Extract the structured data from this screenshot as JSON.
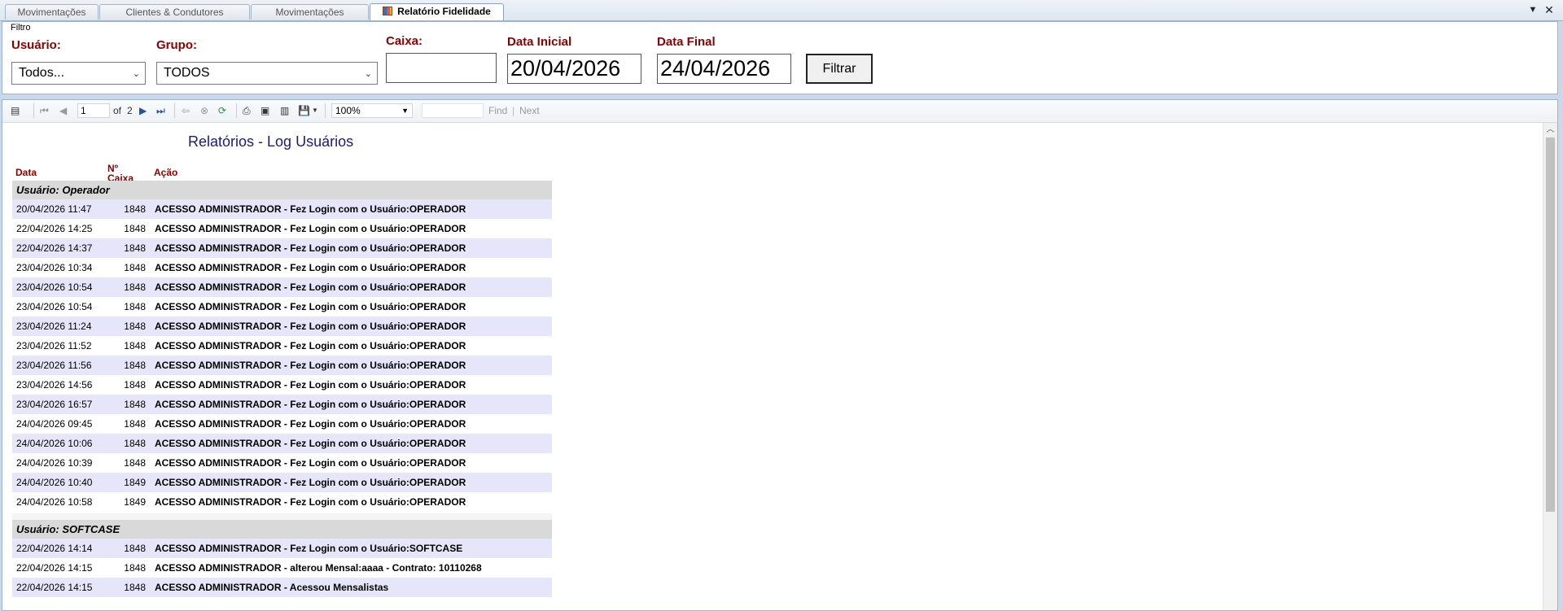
{
  "tabs": [
    {
      "label": "Movimentações"
    },
    {
      "label": "Clientes & Condutores"
    },
    {
      "label": "Movimentações"
    },
    {
      "label": "Relatório Fidelidade"
    }
  ],
  "filter": {
    "legend": "Filtro",
    "usuario_label": "Usuário:",
    "usuario_value": "Todos...",
    "grupo_label": "Grupo:",
    "grupo_value": "TODOS",
    "caixa_label": "Caixa:",
    "caixa_value": "",
    "data_inicial_label": "Data Inicial",
    "data_inicial_value": "20/04/2026",
    "data_final_label": "Data Final",
    "data_final_value": "24/04/2026",
    "filtrar_label": "Filtrar"
  },
  "toolbar": {
    "page_current": "1",
    "page_of": "of",
    "page_total": "2",
    "zoom": "100%",
    "find_label": "Find",
    "separator": "|",
    "next_label": "Next"
  },
  "report": {
    "title": "Relatórios - Log Usuários",
    "col_data": "Data",
    "col_caixa_1": "Nº",
    "col_caixa_2": "Caixa",
    "col_acao": "Ação",
    "groups": [
      {
        "header": "Usuário: Operador",
        "rows": [
          {
            "data": "20/04/2026 11:47",
            "caixa": "1848",
            "acao": "ACESSO ADMINISTRADOR - Fez Login com o Usuário:OPERADOR"
          },
          {
            "data": "22/04/2026 14:25",
            "caixa": "1848",
            "acao": "ACESSO ADMINISTRADOR - Fez Login com o Usuário:OPERADOR"
          },
          {
            "data": "22/04/2026 14:37",
            "caixa": "1848",
            "acao": "ACESSO ADMINISTRADOR - Fez Login com o Usuário:OPERADOR"
          },
          {
            "data": "23/04/2026 10:34",
            "caixa": "1848",
            "acao": "ACESSO ADMINISTRADOR - Fez Login com o Usuário:OPERADOR"
          },
          {
            "data": "23/04/2026 10:54",
            "caixa": "1848",
            "acao": "ACESSO ADMINISTRADOR - Fez Login com o Usuário:OPERADOR"
          },
          {
            "data": "23/04/2026 10:54",
            "caixa": "1848",
            "acao": "ACESSO ADMINISTRADOR - Fez Login com o Usuário:OPERADOR"
          },
          {
            "data": "23/04/2026 11:24",
            "caixa": "1848",
            "acao": "ACESSO ADMINISTRADOR - Fez Login com o Usuário:OPERADOR"
          },
          {
            "data": "23/04/2026 11:52",
            "caixa": "1848",
            "acao": "ACESSO ADMINISTRADOR - Fez Login com o Usuário:OPERADOR"
          },
          {
            "data": "23/04/2026 11:56",
            "caixa": "1848",
            "acao": "ACESSO ADMINISTRADOR - Fez Login com o Usuário:OPERADOR"
          },
          {
            "data": "23/04/2026 14:56",
            "caixa": "1848",
            "acao": "ACESSO ADMINISTRADOR - Fez Login com o Usuário:OPERADOR"
          },
          {
            "data": "23/04/2026 16:57",
            "caixa": "1848",
            "acao": "ACESSO ADMINISTRADOR - Fez Login com o Usuário:OPERADOR"
          },
          {
            "data": "24/04/2026 09:45",
            "caixa": "1848",
            "acao": "ACESSO ADMINISTRADOR - Fez Login com o Usuário:OPERADOR"
          },
          {
            "data": "24/04/2026 10:06",
            "caixa": "1848",
            "acao": "ACESSO ADMINISTRADOR - Fez Login com o Usuário:OPERADOR"
          },
          {
            "data": "24/04/2026 10:39",
            "caixa": "1848",
            "acao": "ACESSO ADMINISTRADOR - Fez Login com o Usuário:OPERADOR"
          },
          {
            "data": "24/04/2026 10:40",
            "caixa": "1849",
            "acao": "ACESSO ADMINISTRADOR - Fez Login com o Usuário:OPERADOR"
          },
          {
            "data": "24/04/2026 10:58",
            "caixa": "1849",
            "acao": "ACESSO ADMINISTRADOR - Fez Login com o Usuário:OPERADOR"
          }
        ]
      },
      {
        "header": "Usuário: SOFTCASE",
        "rows": [
          {
            "data": "22/04/2026 14:14",
            "caixa": "1848",
            "acao": "ACESSO ADMINISTRADOR - Fez Login com o Usuário:SOFTCASE"
          },
          {
            "data": "22/04/2026 14:15",
            "caixa": "1848",
            "acao": "ACESSO ADMINISTRADOR - alterou Mensal:aaaa - Contrato: 10110268"
          },
          {
            "data": "22/04/2026 14:15",
            "caixa": "1848",
            "acao": "ACESSO ADMINISTRADOR - Acessou Mensalistas"
          }
        ]
      }
    ]
  }
}
